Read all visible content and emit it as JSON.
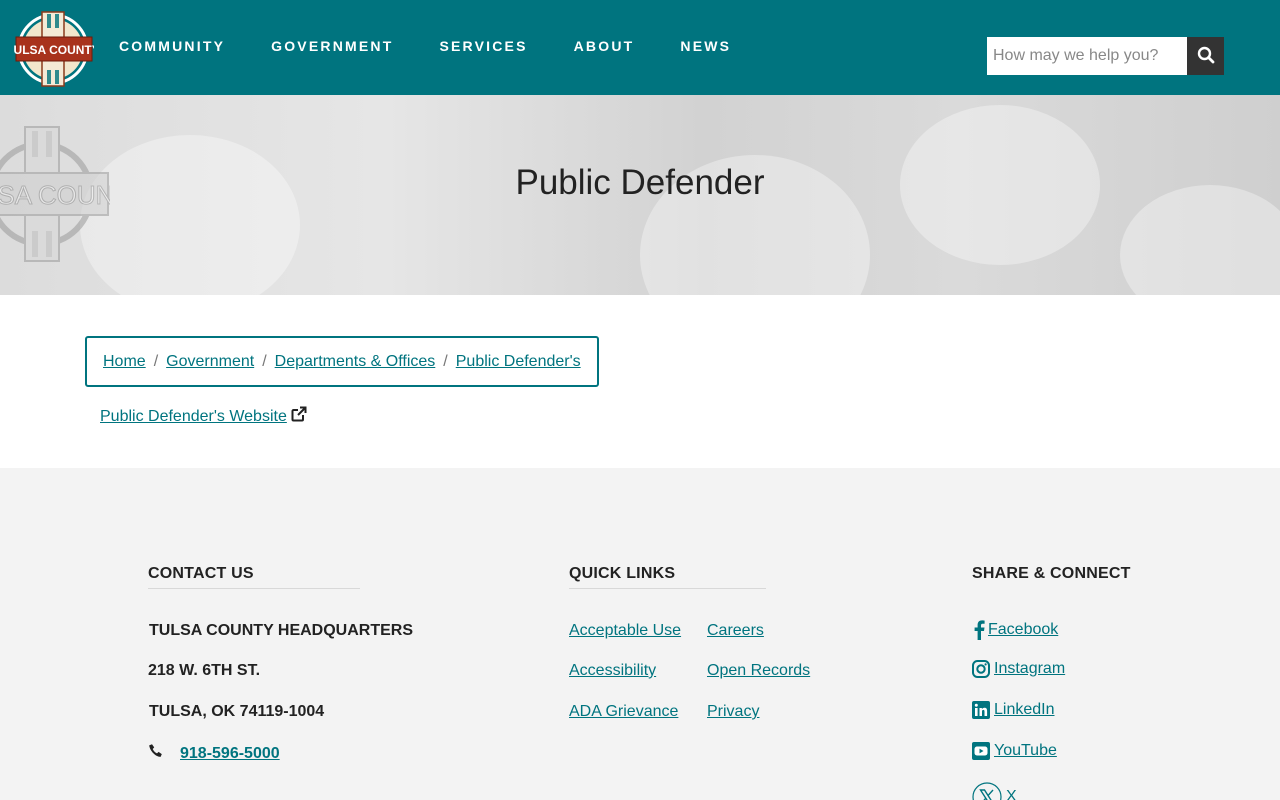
{
  "header": {
    "logo_text": "TULSA COUNTY",
    "nav": [
      {
        "label": "COMMUNITY"
      },
      {
        "label": "GOVERNMENT"
      },
      {
        "label": "SERVICES"
      },
      {
        "label": "ABOUT"
      },
      {
        "label": "NEWS"
      }
    ],
    "search": {
      "placeholder": "How may we help you?",
      "value": ""
    }
  },
  "hero": {
    "title": "Public Defender",
    "watermark_text": "TULSA COUNTY"
  },
  "breadcrumb": [
    {
      "label": "Home"
    },
    {
      "label": "Government"
    },
    {
      "label": "Departments & Offices"
    },
    {
      "label": "Public Defender's"
    }
  ],
  "content": {
    "website_link": "Public Defender's Website"
  },
  "footer": {
    "contact": {
      "heading": "CONTACT US",
      "name": "TULSA COUNTY HEADQUARTERS",
      "street": "218 W. 6TH ST.",
      "city": "TULSA, OK 74119-1004",
      "phone": "918-596-5000"
    },
    "quick_links": {
      "heading": "QUICK LINKS",
      "items": [
        {
          "label": "Acceptable Use"
        },
        {
          "label": "Careers"
        },
        {
          "label": "Accessibility"
        },
        {
          "label": "Open Records"
        },
        {
          "label": "ADA Grievance"
        },
        {
          "label": "Privacy"
        }
      ]
    },
    "share": {
      "heading": "SHARE & CONNECT",
      "items": [
        {
          "label": "Facebook",
          "icon": "facebook-icon"
        },
        {
          "label": "Instagram",
          "icon": "instagram-icon"
        },
        {
          "label": "LinkedIn",
          "icon": "linkedin-icon"
        },
        {
          "label": "YouTube",
          "icon": "youtube-icon"
        },
        {
          "label": "X",
          "icon": "x-icon"
        }
      ]
    }
  },
  "colors": {
    "primary": "#00747f",
    "header_bg": "#00747f",
    "footer_bg": "#f3f3f3",
    "search_button": "#333333"
  }
}
